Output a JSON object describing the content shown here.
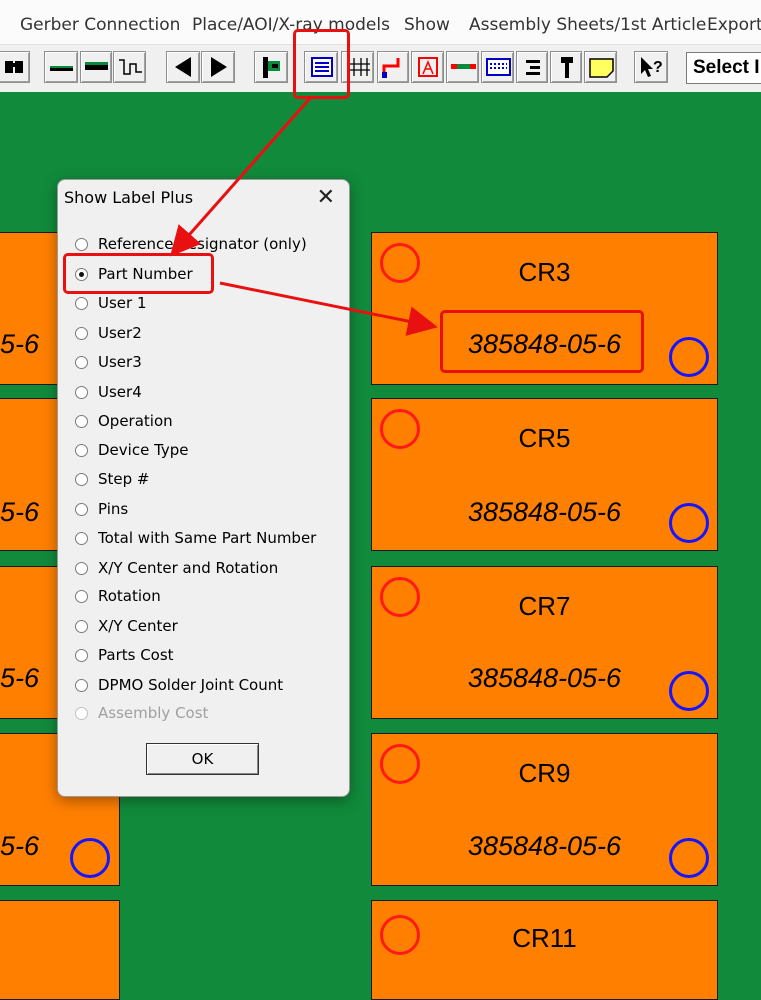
{
  "menu": {
    "items": [
      "Gerber Connection",
      "Place/AOI/X-ray models",
      "Show",
      "Assembly Sheets/1st Article",
      "Export"
    ]
  },
  "toolbar": {
    "select_label": "Select I",
    "help_label": "?",
    "buttons": [
      "binoculars-icon",
      "pad-flat-icon",
      "pad-raised-icon",
      "trace-icon",
      "prev-arrow-icon",
      "next-arrow-icon",
      "flag-icon",
      "label-text-icon",
      "grid-icon",
      "corner-icon",
      "outline-icon",
      "segment-icon",
      "list-icon",
      "align-icon",
      "pin-icon",
      "note-icon",
      "help-cursor-icon"
    ]
  },
  "board": {
    "pads": [
      {
        "ref": "CR3",
        "part": "385848-05-6"
      },
      {
        "ref": "CR5",
        "part": "385848-05-6"
      },
      {
        "ref": "CR7",
        "part": "385848-05-6"
      },
      {
        "ref": "CR9",
        "part": "385848-05-6"
      },
      {
        "ref": "CR11",
        "part": ""
      }
    ],
    "left_fragments": [
      "5-6",
      "5-6",
      "5-6",
      "5-6"
    ]
  },
  "dialog": {
    "title": "Show Label Plus",
    "close": "✕",
    "options": [
      {
        "label": "Reference designator (only)",
        "checked": false,
        "enabled": true
      },
      {
        "label": "Part Number",
        "checked": true,
        "enabled": true
      },
      {
        "label": "User 1",
        "checked": false,
        "enabled": true
      },
      {
        "label": "User2",
        "checked": false,
        "enabled": true
      },
      {
        "label": "User3",
        "checked": false,
        "enabled": true
      },
      {
        "label": "User4",
        "checked": false,
        "enabled": true
      },
      {
        "label": "Operation",
        "checked": false,
        "enabled": true
      },
      {
        "label": "Device Type",
        "checked": false,
        "enabled": true
      },
      {
        "label": "Step #",
        "checked": false,
        "enabled": true
      },
      {
        "label": "Pins",
        "checked": false,
        "enabled": true
      },
      {
        "label": "Total with Same Part Number",
        "checked": false,
        "enabled": true
      },
      {
        "label": "X/Y Center and Rotation",
        "checked": false,
        "enabled": true
      },
      {
        "label": "Rotation",
        "checked": false,
        "enabled": true
      },
      {
        "label": "X/Y Center",
        "checked": false,
        "enabled": true
      },
      {
        "label": "Parts Cost",
        "checked": false,
        "enabled": true
      },
      {
        "label": "DPMO Solder Joint Count",
        "checked": false,
        "enabled": true
      },
      {
        "label": "Assembly Cost",
        "checked": false,
        "enabled": false
      }
    ],
    "ok_label": "OK"
  },
  "colors": {
    "board_green": "#118a3b",
    "pad_orange": "#ff7f00",
    "highlight_red": "#e81010",
    "marker_red": "#ff1a1a",
    "marker_blue": "#1515ff"
  }
}
